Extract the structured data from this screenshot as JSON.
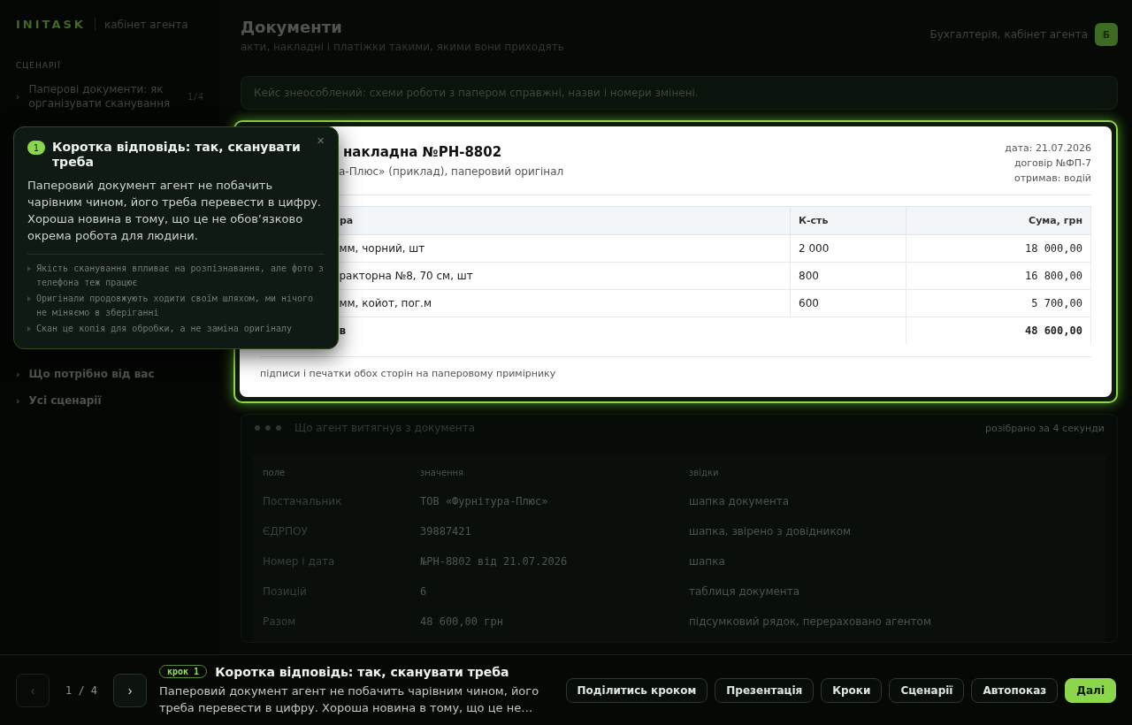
{
  "sidebar": {
    "brand": "INITASK",
    "brand_caption": "кабінет агента",
    "section_label": "СЦЕНАРІЇ",
    "items": [
      {
        "marker": "›",
        "label": "Паперові документи: як організувати сканування",
        "count": "1/4"
      },
      {
        "marker": "›",
        "label": "Що потрібно від вас"
      },
      {
        "marker": "›",
        "label": "Усі сценарії"
      }
    ]
  },
  "header": {
    "title": "Документи",
    "subtitle": "акти, накладні і платіжки такими, якими вони приходять",
    "user": "Бухгалтерія, кабінет агента",
    "avatar": "Б"
  },
  "notice": "Кейс знеособлений: схеми роботи з папером справжні, назви і номери змінені.",
  "document": {
    "title": "накладна №РН-8802",
    "subtitle": "а-Плюс» (приклад), паперовий оригінал",
    "meta": [
      "дата: 21.07.2026",
      "договір №ФП-7",
      "отримав: водій"
    ],
    "columns": [
      "ра",
      "К-сть",
      "Сума, грн"
    ],
    "rows": [
      [
        "мм, чорний, шт",
        "2 000",
        "18 000,00"
      ],
      [
        "ракторна №8, 70 см, шт",
        "800",
        "16 800,00"
      ],
      [
        "мм, койот, пог.м",
        "600",
        "5 700,00"
      ]
    ],
    "total": {
      "label": "в",
      "sum": "48 600,00"
    },
    "footer": "підписи і печатки обох сторін на паперовому примірнику"
  },
  "extraction": {
    "title": "Що агент витягнув з документа",
    "note": "розібрано за 4 секунди",
    "columns": [
      "поле",
      "значення",
      "звідки"
    ],
    "rows": [
      [
        "Постачальник",
        "ТОВ «Фурнітура-Плюс»",
        "шапка документа"
      ],
      [
        "ЄДРПОУ",
        "39887421",
        "шапка, звірено з довідником"
      ],
      [
        "Номер і дата",
        "№РН-8802 від 21.07.2026",
        "шапка"
      ],
      [
        "Позицій",
        "6",
        "таблиця документа"
      ],
      [
        "Разом",
        "48 600,00 грн",
        "підсумковий рядок, перераховано агентом"
      ]
    ]
  },
  "popover": {
    "step": "1",
    "title": "Коротка відповідь: так, сканувати треба",
    "close": "×",
    "body": "Паперовий документ агент не побачить чарівним чином, його треба перевести в цифру. Хороша новина в тому, що це не обов’язково окрема робота для людини.",
    "bullets": [
      "Якість сканування впливає на розпізнавання, але фото з телефона теж працює",
      "Оригінали продовжують ходити своїм шляхом, ми нічого не міняємо в зберіганні",
      "Скан це копія для обробки, а не заміна оригіналу"
    ]
  },
  "tour_bar": {
    "prev": {
      "label": "‹",
      "disabled": true
    },
    "counter": "1 / 4",
    "next": {
      "label": "›",
      "disabled": false
    },
    "badge": "крок 1",
    "title": "Коротка відповідь: так, сканувати треба",
    "text": "Паперовий документ агент не побачить чарівним чином, його треба перевести в цифру. Хороша новина в тому, що це не…",
    "buttons": [
      {
        "label": "Поділитись кроком",
        "primary": false
      },
      {
        "label": "Презентація",
        "primary": false
      },
      {
        "label": "Кроки",
        "primary": false
      },
      {
        "label": "Сценарії",
        "primary": false
      },
      {
        "label": "Автопоказ",
        "primary": false
      },
      {
        "label": "Далі",
        "primary": true
      }
    ]
  }
}
